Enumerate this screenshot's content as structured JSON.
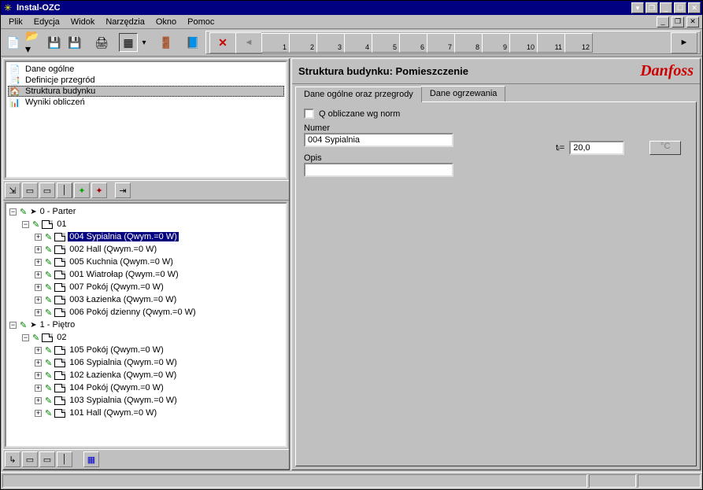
{
  "window": {
    "title": "Instal-OZC"
  },
  "menu": {
    "items": [
      "Plik",
      "Edycja",
      "Widok",
      "Narzędzia",
      "Okno",
      "Pomoc"
    ]
  },
  "toolbar_run": {
    "tabs": [
      "1",
      "2",
      "3",
      "4",
      "5",
      "6",
      "7",
      "8",
      "9",
      "10",
      "11",
      "12"
    ]
  },
  "nav": {
    "items": [
      {
        "label": "Dane ogólne",
        "icon": "sheet"
      },
      {
        "label": "Definicje przegród",
        "icon": "layers"
      },
      {
        "label": "Struktura budynku",
        "icon": "tree",
        "active": true
      },
      {
        "label": "Wyniki obliczeń",
        "icon": "results"
      }
    ]
  },
  "tree": {
    "floors": [
      {
        "label": "0 - Parter",
        "sections": [
          {
            "label": "01",
            "rooms": [
              {
                "label": "004 Sypialnia (Qwym.=0 W)",
                "selected": true
              },
              {
                "label": "002 Hall (Qwym.=0 W)"
              },
              {
                "label": "005 Kuchnia (Qwym.=0 W)"
              },
              {
                "label": "001 Wiatrołap (Qwym.=0 W)"
              },
              {
                "label": "007 Pokój (Qwym.=0 W)"
              },
              {
                "label": "003 Łazienka (Qwym.=0 W)"
              },
              {
                "label": "006 Pokój dzienny (Qwym.=0 W)"
              }
            ]
          }
        ]
      },
      {
        "label": "1 - Piętro",
        "sections": [
          {
            "label": "02",
            "rooms": [
              {
                "label": "105 Pokój (Qwym.=0 W)"
              },
              {
                "label": "106 Sypialnia (Qwym.=0 W)"
              },
              {
                "label": "102 Łazienka (Qwym.=0 W)"
              },
              {
                "label": "104 Pokój (Qwym.=0 W)"
              },
              {
                "label": "103 Sypialnia (Qwym.=0 W)"
              },
              {
                "label": "101 Hall (Qwym.=0 W)"
              }
            ]
          }
        ]
      }
    ]
  },
  "right": {
    "title": "Struktura budynku: Pomieszczenie",
    "brand": "Danfoss",
    "tabs": {
      "a": "Dane ogólne oraz przegrody",
      "b": "Dane ogrzewania"
    },
    "q_check_label": "Q obliczane wg norm",
    "numer_label": "Numer",
    "numer_value": "004 Sypialnia",
    "opis_label": "Opis",
    "opis_value": "",
    "ti_label": "tᵢ=",
    "ti_value": "20,0",
    "ti_unit": "°C"
  }
}
